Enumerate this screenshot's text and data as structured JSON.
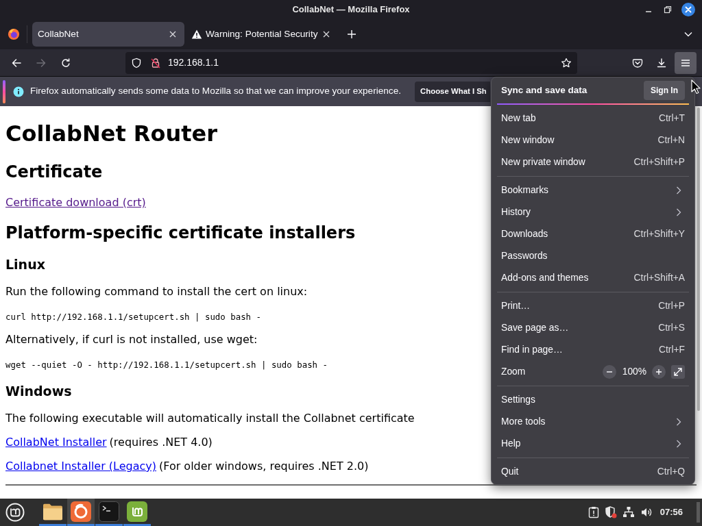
{
  "window": {
    "title": "CollabNet — Mozilla Firefox"
  },
  "tabs": [
    {
      "label": "CollabNet",
      "kind": "page",
      "selected": true
    },
    {
      "label": "Warning: Potential Security",
      "kind": "warning",
      "selected": false
    }
  ],
  "toolbar": {
    "back": {
      "disabled": false
    },
    "forward": {
      "disabled": true
    },
    "address": "192.168.1.1",
    "menu_open": true
  },
  "notification": {
    "message": "Firefox automatically sends some data to Mozilla so that we can improve your experience.",
    "button": "Choose What I Sh"
  },
  "page": {
    "blocks": [
      {
        "kind": "h1",
        "text": "CollabNet Router"
      },
      {
        "kind": "h2",
        "text": "Certificate"
      },
      {
        "kind": "link_line",
        "link": "Certificate download (crt)",
        "visited": true
      },
      {
        "kind": "h2",
        "text": "Platform-specific certificate installers"
      },
      {
        "kind": "h3",
        "text": "Linux"
      },
      {
        "kind": "text",
        "text": "Run the following command to install the cert on linux:"
      },
      {
        "kind": "code",
        "text": "curl http://192.168.1.1/setupcert.sh | sudo bash -"
      },
      {
        "kind": "text",
        "text": "Alternatively, if curl is not installed, use wget:"
      },
      {
        "kind": "code",
        "text": "wget --quiet -O - http://192.168.1.1/setupcert.sh | sudo bash -"
      },
      {
        "kind": "h3",
        "text": "Windows"
      },
      {
        "kind": "text",
        "text": "The following executable will automatically install the Collabnet certificate"
      },
      {
        "kind": "link_line",
        "link": "CollabNet Installer",
        "text": "(requires .NET 4.0)",
        "visited": false
      },
      {
        "kind": "link_line",
        "link": "Collabnet Installer (Legacy)",
        "text": "(For older windows, requires .NET 2.0)",
        "visited": false
      },
      {
        "kind": "rule"
      }
    ]
  },
  "menu": {
    "header": "Sync and save data",
    "sign_in": "Sign In",
    "sections": [
      [
        {
          "kind": "item",
          "label": "New tab",
          "shortcut": "Ctrl+T"
        },
        {
          "kind": "item",
          "label": "New window",
          "shortcut": "Ctrl+N"
        },
        {
          "kind": "item",
          "label": "New private window",
          "shortcut": "Ctrl+Shift+P"
        }
      ],
      [
        {
          "kind": "submenu",
          "label": "Bookmarks"
        },
        {
          "kind": "submenu",
          "label": "History"
        },
        {
          "kind": "item",
          "label": "Downloads",
          "shortcut": "Ctrl+Shift+Y"
        },
        {
          "kind": "item",
          "label": "Passwords"
        },
        {
          "kind": "item",
          "label": "Add-ons and themes",
          "shortcut": "Ctrl+Shift+A"
        }
      ],
      [
        {
          "kind": "item",
          "label": "Print…",
          "shortcut": "Ctrl+P"
        },
        {
          "kind": "item",
          "label": "Save page as…",
          "shortcut": "Ctrl+S"
        },
        {
          "kind": "item",
          "label": "Find in page…",
          "shortcut": "Ctrl+F"
        },
        {
          "kind": "zoom",
          "label": "Zoom",
          "value": "100%"
        }
      ],
      [
        {
          "kind": "item",
          "label": "Settings"
        },
        {
          "kind": "submenu",
          "label": "More tools"
        },
        {
          "kind": "submenu",
          "label": "Help"
        }
      ],
      [
        {
          "kind": "item",
          "label": "Quit",
          "shortcut": "Ctrl+Q"
        }
      ]
    ]
  },
  "taskbar": {
    "apps": [
      {
        "kind": "files",
        "running": true,
        "selected": false
      },
      {
        "kind": "browser",
        "running": true,
        "selected": true
      },
      {
        "kind": "terminal",
        "running": true,
        "selected": false
      },
      {
        "kind": "software",
        "running": true,
        "selected": false
      }
    ],
    "clock": "07:56"
  }
}
